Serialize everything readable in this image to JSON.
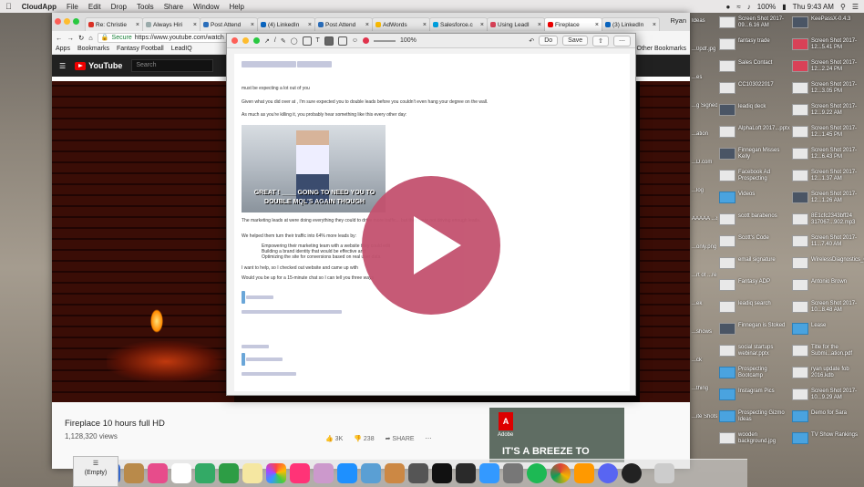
{
  "menubar": {
    "app": "CloudApp",
    "items": [
      "File",
      "Edit",
      "Drop",
      "Tools",
      "Share",
      "Window",
      "Help"
    ],
    "battery": "100%",
    "clock": "Thu 9:43 AM"
  },
  "browser": {
    "tabs": [
      "Re: Christie",
      "Always Hiri",
      "Post Attend",
      "(4) LinkedIn",
      "Post Attend",
      "AdWords",
      "Salesforce.c",
      "Using LeadI",
      "Fireplace",
      "(3) LinkedIn"
    ],
    "profile": "Ryan",
    "secure_label": "Secure",
    "url": "https://www.youtube.com/watch",
    "bookmarks": [
      "Apps",
      "Bookmarks",
      "Fantasy Football",
      "LeadIQ"
    ],
    "other_bookmarks": "Other Bookmarks"
  },
  "youtube": {
    "logo": "YouTube",
    "search_placeholder": "Search",
    "video_title": "Fireplace 10 hours full HD",
    "views": "1,128,320 views",
    "likes": "3K",
    "dislikes": "238",
    "share": "SHARE",
    "ad_brand": "Adobe",
    "ad_tagline": "IT'S A BREEZE TO"
  },
  "annotator": {
    "buttons": {
      "do": "Do",
      "save": "Save"
    },
    "zoom": "100%",
    "doc_lines": [
      "must be expecting a lot out of you",
      "Given what you did over at    , I'm sure    expected you to double leads before you couldn't even hang your    degree on the wall.",
      "As much as you're killing it, you probably hear something like this every other day:",
      "The marketing leads at    were doing everything they could to drive more traffic... but they were not driving enough leads.",
      "We helped them turn their traffic into 64% more leads by:",
      "Empowering their marketing team with a website they could edit",
      "Building a brand identity that would be effective and",
      "Optimizing the site for conversions based on real user data",
      "I want to help, so I checked out    website and came up with",
      "Would you be up for a 15-minute chat so I can tell you three ways"
    ],
    "meme_caption": "GREAT ! ____ GOING TO NEED YOU TO DOUBLE MQL'S AGAIN THOUGH"
  },
  "desktop_right": [
    {
      "label": "Screen Shot 2017-09...6.16 AM",
      "kind": "shot"
    },
    {
      "label": "KeePassX-0.4.3",
      "kind": "dark"
    },
    {
      "label": "fantasy trade",
      "kind": "shot"
    },
    {
      "label": "Screen Shot 2017-12...5.41 PM",
      "kind": "red"
    },
    {
      "label": "Sales Contact",
      "kind": "shot"
    },
    {
      "label": "Screen Shot 2017-12...2.24 PM",
      "kind": "red"
    },
    {
      "label": "CC103022017",
      "kind": "shot"
    },
    {
      "label": "Screen Shot 2017-12...3.05 PM",
      "kind": "shot"
    },
    {
      "label": "leadiq deck",
      "kind": "dark"
    },
    {
      "label": "Screen Shot 2017-12...9.22 AM",
      "kind": "shot"
    },
    {
      "label": "AlphaLoft 2017...pptx",
      "kind": "shot"
    },
    {
      "label": "Screen Shot 2017-12...1.45 PM",
      "kind": "shot"
    },
    {
      "label": "Finnegan Misses Kelly",
      "kind": "dark"
    },
    {
      "label": "Screen Shot 2017-12...6.43 PM",
      "kind": "shot"
    },
    {
      "label": "Facebook Ad Prospecting",
      "kind": "shot"
    },
    {
      "label": "Screen Shot 2017-12...1.37 AM",
      "kind": "shot"
    },
    {
      "label": "Videos",
      "kind": "folder"
    },
    {
      "label": "Screen Shot 2017-12...1.26 AM",
      "kind": "dark"
    },
    {
      "label": "scott barabenos",
      "kind": "shot"
    },
    {
      "label": "8E1cfc2343bff24 317067...902.mp3",
      "kind": "shot"
    },
    {
      "label": "Scott's Code",
      "kind": "shot"
    },
    {
      "label": "Screen Shot 2017-11...7.40 AM",
      "kind": "shot"
    },
    {
      "label": "email signature",
      "kind": "shot"
    },
    {
      "label": "WirelessDiagnostics_C02S...8.tar.gz",
      "kind": "shot"
    },
    {
      "label": "Fantasy ADP",
      "kind": "shot"
    },
    {
      "label": "Antonio Brown",
      "kind": "shot"
    },
    {
      "label": "leadiq search",
      "kind": "shot"
    },
    {
      "label": "Screen Shot 2017-10...8.48 AM",
      "kind": "shot"
    },
    {
      "label": "Finnegan is Stoked",
      "kind": "dark"
    },
    {
      "label": "Lease",
      "kind": "folder"
    },
    {
      "label": "social startups webinar.pptx",
      "kind": "shot"
    },
    {
      "label": "Title for the Submi...ation.pdf",
      "kind": "shot"
    },
    {
      "label": "Prospecting Bootcamp",
      "kind": "folder"
    },
    {
      "label": "ryan update fob 2016.kdb",
      "kind": "shot"
    },
    {
      "label": "Instagram Pics",
      "kind": "folder"
    },
    {
      "label": "Screen Shot 2017-10...9.29 AM",
      "kind": "shot"
    },
    {
      "label": "Prospecting Gizmo Ideas",
      "kind": "folder"
    },
    {
      "label": "Demo for Sara",
      "kind": "folder"
    },
    {
      "label": "wooden background.jpg",
      "kind": "shot"
    },
    {
      "label": "TV Show Rankings",
      "kind": "folder"
    }
  ],
  "desktop_partial": [
    "Ideas",
    "...0pdf.jpg",
    "...es",
    "...g Signed",
    "...ation",
    "...D.com",
    "...log",
    "AAAAA ...8Q.png",
    "...only.png",
    "...rt of ...ressions",
    "...ek",
    "...shows",
    "...ck",
    "...thing",
    "...ite Shots"
  ],
  "dock": {
    "empty_label": "(Empty)"
  },
  "colors": {
    "play_button": "#c3526f",
    "youtube_red": "#ee0000"
  }
}
